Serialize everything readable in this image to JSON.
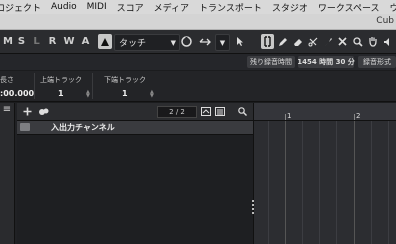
{
  "menubar": {
    "items": [
      "プロジェクト",
      "Audio",
      "MIDI",
      "スコア",
      "メディア",
      "トランスポート",
      "スタジオ",
      "ワークスペース",
      "ウ"
    ]
  },
  "titlebar": {
    "title": "Cub"
  },
  "toolbar": {
    "mode_buttons": [
      "M",
      "S",
      "L",
      "R",
      "W",
      "A"
    ],
    "automation_mode": "タッチ",
    "icons": [
      "pointer-icon",
      "range-select-icon",
      "pencil-icon",
      "eraser-icon",
      "scissors-icon",
      "glue-icon",
      "mute-x-icon",
      "zoom-icon",
      "hand-icon",
      "speaker-icon"
    ]
  },
  "infobar": {
    "remaining_label": "残り録音時間",
    "remaining_value": "1454 時間 30 分",
    "format_label": "録音形式"
  },
  "lineinfo": {
    "f1_label": "長さ",
    "f1_value": ":00.000",
    "f2_label": "上端トラック",
    "f2_value": "1",
    "f3_label": "下端トラック",
    "f3_value": "1"
  },
  "tracklist": {
    "count": "2 / 2",
    "tracks": [
      {
        "name": "入出力チャンネル"
      }
    ]
  },
  "ruler": {
    "marks": [
      "1",
      "2"
    ]
  }
}
